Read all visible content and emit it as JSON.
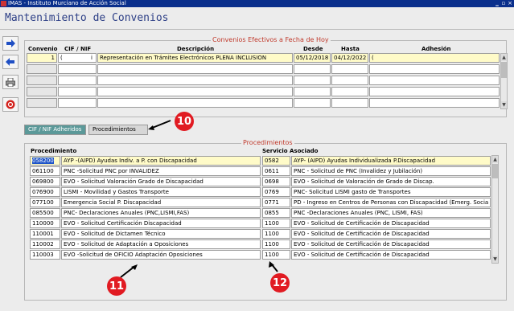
{
  "window": {
    "title": "IMAS - Instituto Murciano de Acción Social"
  },
  "page": {
    "heading": "Mantenimiento de Convenios"
  },
  "sidebar": {
    "items": [
      {
        "name": "next-record",
        "icon": "arrow-right-icon"
      },
      {
        "name": "previous-record",
        "icon": "arrow-left-icon"
      },
      {
        "name": "print",
        "icon": "printer-icon"
      },
      {
        "name": "exit",
        "icon": "exit-icon"
      }
    ]
  },
  "convenios": {
    "legend": "Convenios Efectivos a Fecha de Hoy",
    "headers": {
      "convenio": "Convenio",
      "cif": "CIF / NIF",
      "descripcion": "Descripción",
      "desde": "Desde",
      "hasta": "Hasta",
      "adhesion": "Adhesión"
    },
    "rows": [
      {
        "convenio": "1",
        "cif": "(",
        "cif_mark": "i",
        "descripcion": "Representación en Trámites Electrónicos PLENA INCLUSION",
        "desde": "05/12/2018",
        "hasta": "04/12/2022",
        "adhesion": "("
      }
    ]
  },
  "tabs": [
    {
      "label": "CIF / NIF Adheridos",
      "active": true
    },
    {
      "label": "Procedimientos",
      "active": false
    }
  ],
  "procedimientos": {
    "legend": "Procedimientos",
    "headers": {
      "procedimiento": "Procedimiento",
      "servicio": "Servicio Asociado"
    },
    "rows": [
      {
        "code": "058200",
        "desc": "AYP -(AIPD) Ayudas Indiv. a P. con Discapacidad",
        "scode": "0582",
        "sdesc": "AYP- (AIPD) Ayudas Individualizada P.Discapacidad"
      },
      {
        "code": "061100",
        "desc": "PNC -Solicitud PNC por INVALIDEZ",
        "scode": "0611",
        "sdesc": "PNC - Solicitud de PNC (Invalidez y Jubilación)"
      },
      {
        "code": "069800",
        "desc": "EVO - Solicitud Valoración Grado de Discapacidad",
        "scode": "0698",
        "sdesc": "EVO - Solicitud de Valoración de Grado de Discap."
      },
      {
        "code": "076900",
        "desc": "LISMI - Movilidad y Gastos Transporte",
        "scode": "0769",
        "sdesc": "PNC- Solicitud LISMI gasto de Transportes"
      },
      {
        "code": "077100",
        "desc": "Emergencia Social P. Discapacidad",
        "scode": "0771",
        "sdesc": "PD - Ingreso en Centros de Personas con Discapacidad (Emerg. Socia"
      },
      {
        "code": "085500",
        "desc": "PNC- Declaraciones Anuales (PNC,LISMI,FAS)",
        "scode": "0855",
        "sdesc": "PNC -Declaraciones Anuales (PNC, LISMI, FAS)"
      },
      {
        "code": "110000",
        "desc": "EVO - Solicitud Certificación Discapacidad",
        "scode": "1100",
        "sdesc": "EVO - Solicitud de Certificación de Discapacidad"
      },
      {
        "code": "110001",
        "desc": "EVO - Solicitud de Dictamen Técnico",
        "scode": "1100",
        "sdesc": "EVO - Solicitud de Certificación de Discapacidad"
      },
      {
        "code": "110002",
        "desc": "EVO - Solicitud de Adaptación a Oposiciones",
        "scode": "1100",
        "sdesc": "EVO - Solicitud de Certificación de Discapacidad"
      },
      {
        "code": "110003",
        "desc": "EVO -Solicitud de OFICIO Adaptación Oposiciones",
        "scode": "1100",
        "sdesc": "EVO - Solicitud de Certificación de Discapacidad"
      }
    ]
  },
  "annotations": [
    {
      "label": "10"
    },
    {
      "label": "11"
    },
    {
      "label": "12"
    }
  ]
}
